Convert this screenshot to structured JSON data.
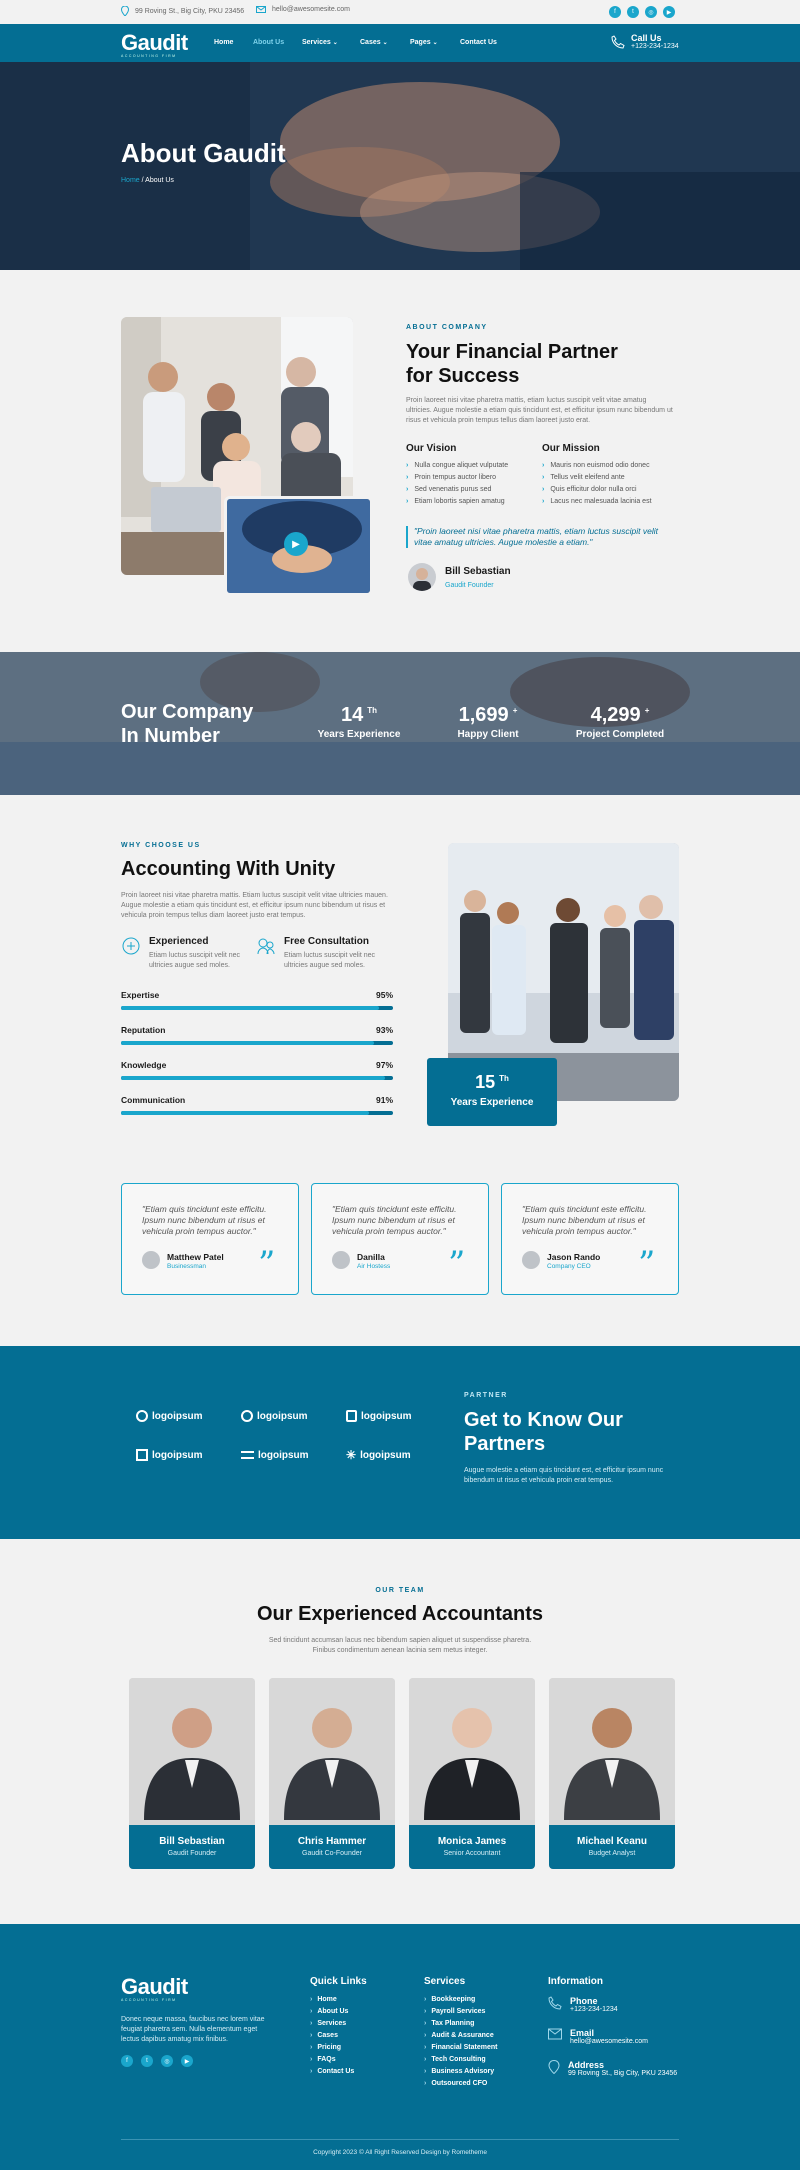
{
  "topbar": {
    "address": "99 Roving St., Big City, PKU 23456",
    "email": "hello@awesomesite.com",
    "social": [
      "facebook-icon",
      "twitter-icon",
      "instagram-icon",
      "youtube-icon"
    ]
  },
  "brand": {
    "name": "Gaudit",
    "tagline": "ACCOUNTING FIRM"
  },
  "nav": {
    "items": [
      "Home",
      "About Us",
      "Services",
      "Cases",
      "Pages",
      "Contact Us"
    ],
    "active": "About Us",
    "call_label": "Call Us",
    "call_number": "+123-234-1234"
  },
  "hero": {
    "title": "About Gaudit",
    "crumb_home": "Home",
    "crumb_current": "/ About Us"
  },
  "about": {
    "label": "ABOUT COMPANY",
    "title_line1": "Your Financial Partner",
    "title_line2": "for Success",
    "text": "Proin laoreet nisi vitae pharetra mattis, etiam luctus suscipit velit vitae amatug ultricies. Augue molestie a etiam quis tincidunt est, et efficitur ipsum nunc bibendum ut risus et vehicula proin tempus tellus diam laoreet justo erat.",
    "vision_title": "Our Vision",
    "vision": [
      "Nulla congue aliquet vulputate",
      "Proin tempus auctor libero",
      "Sed venenatis purus sed",
      "Etiam lobortis sapien amatug"
    ],
    "mission_title": "Our Mission",
    "mission": [
      "Mauris non euismod odio donec",
      "Tellus velit eleifend ante",
      "Quis efficitur dolor nulla orci",
      "Lacus nec malesuada lacinia est"
    ],
    "quote": "\"Proin laoreet nisi vitae pharetra mattis, etiam luctus suscipit velit vitae amatug ultricies. Augue molestie a etiam.\"",
    "person_name": "Bill Sebastian",
    "person_role": "Gaudit Founder"
  },
  "numbers": {
    "title_line1": "Our Company",
    "title_line2": "In Number",
    "stats": [
      {
        "value": "14",
        "sup": "Th",
        "label": "Years Experience"
      },
      {
        "value": "1,699",
        "sup": "+",
        "label": "Happy Client"
      },
      {
        "value": "4,299",
        "sup": "+",
        "label": "Project Completed"
      }
    ]
  },
  "choose": {
    "label": "WHY CHOOSE US",
    "title": "Accounting With Unity",
    "text": "Proin laoreet nisi vitae pharetra mattis. Etiam luctus suscipit velit vitae ultricies mauen. Augue molestie a etiam quis tincidunt est, et efficitur ipsum nunc bibendum ut risus et vehicula proin tempus tellus diam laoreet justo erat tempus.",
    "features": [
      {
        "title": "Experienced",
        "text": "Etiam luctus suscipit velit nec ultricies augue sed moles."
      },
      {
        "title": "Free Consultation",
        "text": "Etiam luctus suscipit velit nec ultricies augue sed moles."
      }
    ],
    "skills": [
      {
        "name": "Expertise",
        "label": "95%",
        "value": 95
      },
      {
        "name": "Reputation",
        "label": "93%",
        "value": 93
      },
      {
        "name": "Knowledge",
        "label": "97%",
        "value": 97
      },
      {
        "name": "Communication",
        "label": "91%",
        "value": 91
      }
    ],
    "badge_value": "15",
    "badge_sup": "Th",
    "badge_label": "Years Experience"
  },
  "testimonials": [
    {
      "quote": "\"Etiam quis tincidunt este efficitu. Ipsum nunc bibendum ut risus et vehicula proin tempus auctor.\"",
      "name": "Matthew Patel",
      "role": "Businessman"
    },
    {
      "quote": "\"Etiam quis tincidunt este efficitu. Ipsum nunc bibendum ut risus et vehicula proin tempus auctor.\"",
      "name": "Danilla",
      "role": "Air Hostess"
    },
    {
      "quote": "\"Etiam quis tincidunt este efficitu. Ipsum nunc bibendum ut risus et vehicula proin tempus auctor.\"",
      "name": "Jason Rando",
      "role": "Company CEO"
    }
  ],
  "partners": {
    "label": "PARTNER",
    "title_line1": "Get to Know Our",
    "title_line2": "Partners",
    "text": "Augue molestie a etiam quis tincidunt est, et efficitur ipsum nunc bibendum ut risus et vehicula proin erat tempus.",
    "logos": [
      "logoipsum",
      "logoipsum",
      "logoipsum",
      "logoipsum",
      "logoipsum",
      "logoipsum"
    ]
  },
  "team": {
    "label": "OUR TEAM",
    "title": "Our Experienced Accountants",
    "text_line1": "Sed tincidunt accumsan lacus nec bibendum sapien aliquet ut suspendisse pharetra.",
    "text_line2": "Finibus condimentum aenean lacinia sem metus integer.",
    "members": [
      {
        "name": "Bill Sebastian",
        "role": "Gaudit Founder"
      },
      {
        "name": "Chris Hammer",
        "role": "Gaudit Co-Founder"
      },
      {
        "name": "Monica James",
        "role": "Senior Accountant"
      },
      {
        "name": "Michael Keanu",
        "role": "Budget Analyst"
      }
    ]
  },
  "footer": {
    "about": "Donec neque massa, faucibus nec lorem vitae feugiat pharetra sem. Nulla elementum eget lectus dapibus amatug mix finibus.",
    "quick_title": "Quick Links",
    "quick": [
      "Home",
      "About Us",
      "Services",
      "Cases",
      "Pricing",
      "FAQs",
      "Contact Us"
    ],
    "services_title": "Services",
    "services": [
      "Bookkeeping",
      "Payroll Services",
      "Tax Planning",
      "Audit & Assurance",
      "Financial Statement",
      "Tech Consulting",
      "Business Advisory",
      "Outsourced CFO"
    ],
    "info_title": "Information",
    "phone_label": "Phone",
    "phone": "+123-234-1234",
    "email_label": "Email",
    "email": "hello@awesomesite.com",
    "address_label": "Address",
    "address": "99 Roving St., Big City, PKU 23456",
    "copyright": "Copyright 2023 © All Right Reserved Design by Rometheme"
  }
}
